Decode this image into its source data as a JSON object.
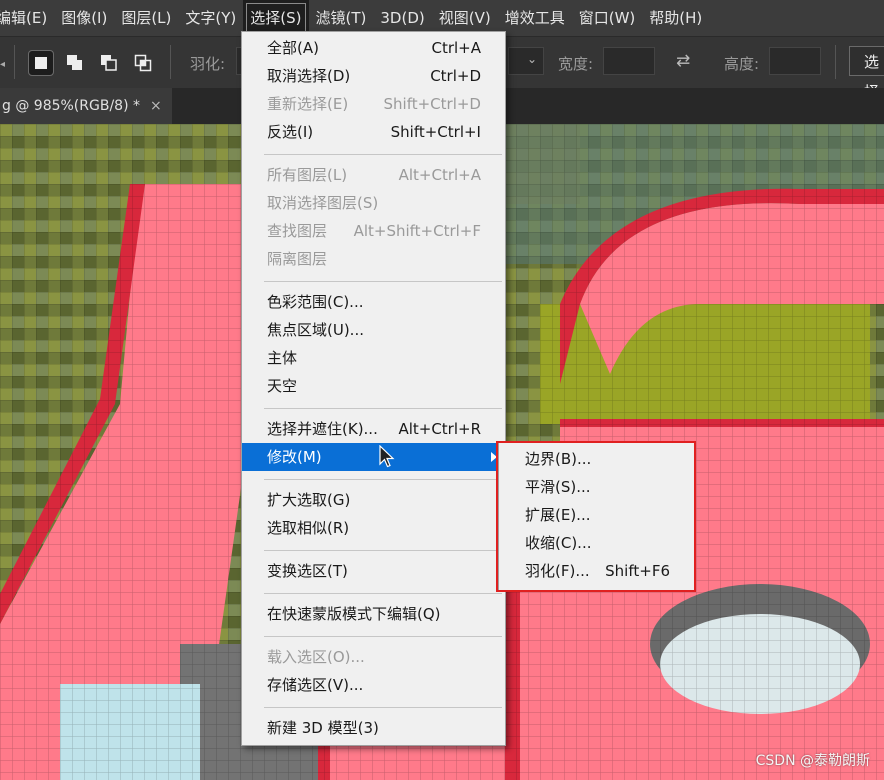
{
  "menubar": {
    "items": [
      {
        "label": "编辑(E)"
      },
      {
        "label": "图像(I)"
      },
      {
        "label": "图层(L)"
      },
      {
        "label": "文字(Y)"
      },
      {
        "label": "选择(S)"
      },
      {
        "label": "滤镜(T)"
      },
      {
        "label": "3D(D)"
      },
      {
        "label": "视图(V)"
      },
      {
        "label": "增效工具"
      },
      {
        "label": "窗口(W)"
      },
      {
        "label": "帮助(H)"
      }
    ]
  },
  "options_bar": {
    "feather_label": "羽化:",
    "width_label": "宽度:",
    "height_label": "高度:",
    "select_button": "选择"
  },
  "document_tab": {
    "title": "g @ 985%(RGB/8) *",
    "close": "×"
  },
  "select_menu": {
    "items": [
      {
        "label": "全部(A)",
        "shortcut": "Ctrl+A"
      },
      {
        "label": "取消选择(D)",
        "shortcut": "Ctrl+D"
      },
      {
        "label": "重新选择(E)",
        "shortcut": "Shift+Ctrl+D"
      },
      {
        "label": "反选(I)",
        "shortcut": "Shift+Ctrl+I"
      },
      {
        "label": "所有图层(L)",
        "shortcut": "Alt+Ctrl+A"
      },
      {
        "label": "取消选择图层(S)",
        "shortcut": ""
      },
      {
        "label": "查找图层",
        "shortcut": "Alt+Shift+Ctrl+F"
      },
      {
        "label": "隔离图层",
        "shortcut": ""
      },
      {
        "label": "色彩范围(C)...",
        "shortcut": ""
      },
      {
        "label": "焦点区域(U)...",
        "shortcut": ""
      },
      {
        "label": "主体",
        "shortcut": ""
      },
      {
        "label": "天空",
        "shortcut": ""
      },
      {
        "label": "选择并遮住(K)...",
        "shortcut": "Alt+Ctrl+R"
      },
      {
        "label": "修改(M)",
        "shortcut": ""
      },
      {
        "label": "扩大选取(G)",
        "shortcut": ""
      },
      {
        "label": "选取相似(R)",
        "shortcut": ""
      },
      {
        "label": "变换选区(T)",
        "shortcut": ""
      },
      {
        "label": "在快速蒙版模式下编辑(Q)",
        "shortcut": ""
      },
      {
        "label": "载入选区(O)...",
        "shortcut": ""
      },
      {
        "label": "存储选区(V)...",
        "shortcut": ""
      },
      {
        "label": "新建 3D 模型(3)",
        "shortcut": ""
      }
    ]
  },
  "modify_submenu": {
    "items": [
      {
        "label": "边界(B)...",
        "shortcut": ""
      },
      {
        "label": "平滑(S)...",
        "shortcut": ""
      },
      {
        "label": "扩展(E)...",
        "shortcut": ""
      },
      {
        "label": "收缩(C)...",
        "shortcut": ""
      },
      {
        "label": "羽化(F)...",
        "shortcut": "Shift+F6"
      }
    ]
  },
  "watermark": "CSDN @泰勒朗斯",
  "colors": {
    "menu_highlight": "#0a6fd6",
    "annotation_red": "#e02020",
    "pink": "#ff7a8a"
  }
}
